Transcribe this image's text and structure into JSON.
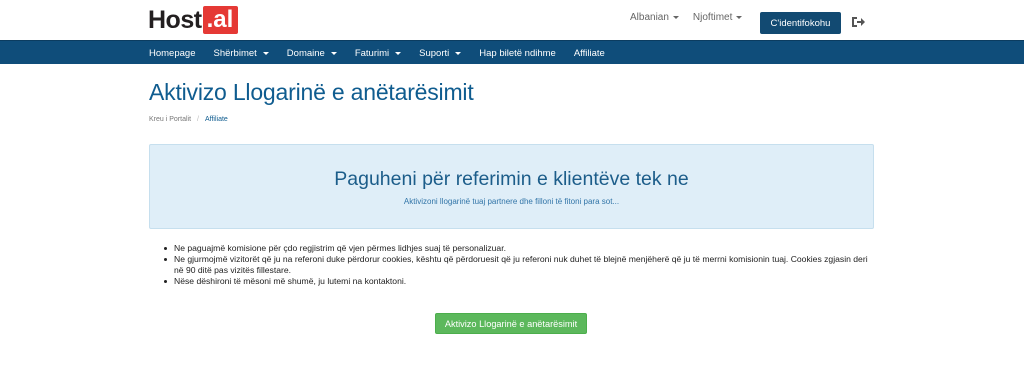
{
  "header": {
    "logo_part1": "Host",
    "logo_part2": ".al",
    "language_label": "Albanian",
    "notifications_label": "Njoftimet",
    "login_button": "C'identifokohu"
  },
  "nav": {
    "items": [
      {
        "label": "Homepage",
        "dropdown": false
      },
      {
        "label": "Shërbimet",
        "dropdown": true
      },
      {
        "label": "Domaine",
        "dropdown": true
      },
      {
        "label": "Faturimi",
        "dropdown": true
      },
      {
        "label": "Suporti",
        "dropdown": true
      },
      {
        "label": "Hap biletë ndihme",
        "dropdown": false
      },
      {
        "label": "Affiliate",
        "dropdown": false
      }
    ]
  },
  "page": {
    "title": "Aktivizo Llogarinë e anëtarësimit",
    "breadcrumb": [
      "Kreu i Portalit",
      "Affiliate"
    ]
  },
  "hero": {
    "title": "Paguheni për referimin e klientëve tek ne",
    "subtitle": "Aktivizoni llogarinë tuaj partnere dhe filloni të fitoni para sot..."
  },
  "bullets": [
    "Ne paguajmë komisione për çdo regjistrim që vjen përmes lidhjes suaj të personalizuar.",
    "Ne gjurmojmë vizitorët që ju na referoni duke përdorur cookies, kështu që përdoruesit që ju referoni nuk duhet të blejnë menjëherë që ju të merrni komisionin tuaj. Cookies zgjasin deri në 90 ditë pas vizitës fillestare.",
    "Nëse dëshironi të mësoni më shumë, ju lutemi na kontaktoni."
  ],
  "activate_button": "Aktivizo Llogarinë e anëtarësimit",
  "colors": {
    "nav_bg": "#0f4d7a",
    "brand_red": "#e53935",
    "title_blue": "#0f5c8f",
    "hero_bg": "#dfeef8",
    "button_green": "#5cb85c"
  }
}
